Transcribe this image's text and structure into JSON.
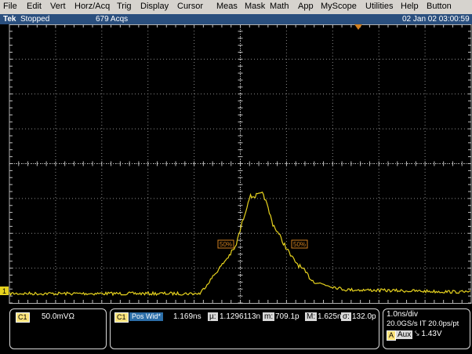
{
  "menu": [
    "File",
    "Edit",
    "Vert",
    "Horz/Acq",
    "Trig",
    "Display",
    "Cursor",
    "Meas",
    "Mask",
    "Math",
    "App",
    "MyScope",
    "Utilities",
    "Help",
    "Button"
  ],
  "status": {
    "brand": "Tek",
    "state": "Stopped",
    "acqs": "679 Acqs",
    "datetime": "02 Jan 02 03:00:59"
  },
  "channel_marker": "1",
  "markers": {
    "left": "50%",
    "right": "50%"
  },
  "bottom": {
    "ch_label": "C1",
    "ch_scale": "50.0mVΩ",
    "meas_ch": "C1",
    "meas_name": "Pos Wid*",
    "meas_value": "1.169ns",
    "mu_label": "µ:",
    "mu_value": "1.1296113n",
    "m_label": "m:",
    "m_value": "709.1p",
    "M_label": "M:",
    "M_value": "1.625n",
    "sigma_label": "σ:",
    "sigma_value": "132.0p",
    "timebase": "1.0ns/div",
    "rate": "20.0GS/s IT 20.0ps/pt",
    "trig_src": "A",
    "trig_aux": "Aux",
    "trig_level": "⤥ 1.43V"
  },
  "colors": {
    "trace": "#e6d21e",
    "menubar": "#d6d3ce",
    "status": "#2a4f7e",
    "marker": "#d08020"
  }
}
